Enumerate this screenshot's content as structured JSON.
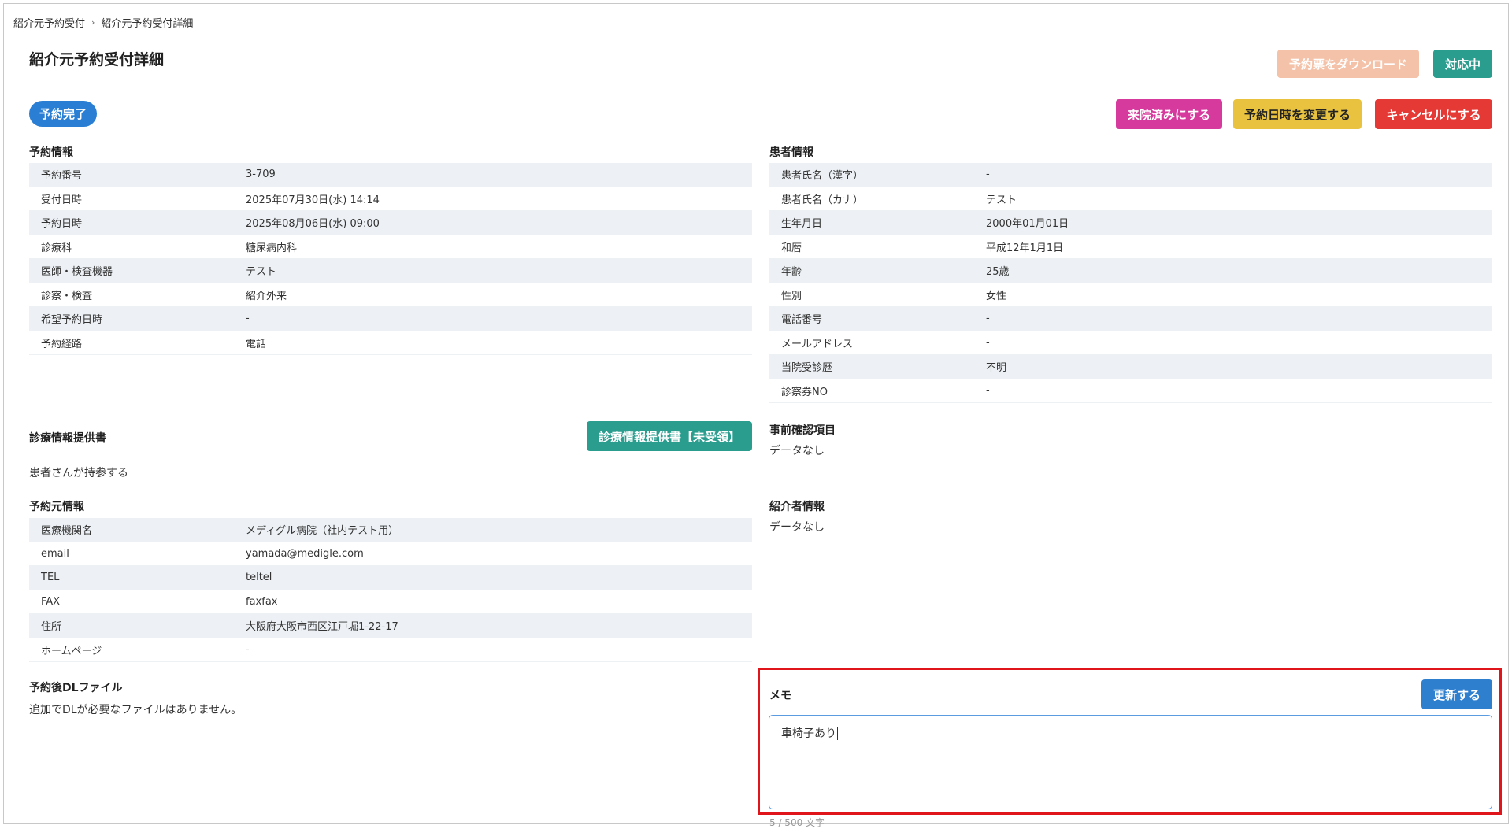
{
  "breadcrumb": {
    "items": [
      "紹介元予約受付",
      "紹介元予約受付詳細"
    ],
    "separator": "›"
  },
  "page_title": "紹介元予約受付詳細",
  "header_buttons": {
    "download": "予約票をダウンロード",
    "status": "対応中"
  },
  "status_badge": "予約完了",
  "action_buttons": {
    "visited": "来院済みにする",
    "reschedule": "予約日時を変更する",
    "cancel": "キャンセルにする"
  },
  "reservation_info": {
    "title": "予約情報",
    "rows": [
      {
        "label": "予約番号",
        "value": "3-709"
      },
      {
        "label": "受付日時",
        "value": "2025年07月30日(水) 14:14"
      },
      {
        "label": "予約日時",
        "value": "2025年08月06日(水) 09:00"
      },
      {
        "label": "診療科",
        "value": "糖尿病内科"
      },
      {
        "label": "医師・検査機器",
        "value": "テスト"
      },
      {
        "label": "診察・検査",
        "value": "紹介外来"
      },
      {
        "label": "希望予約日時",
        "value": "-"
      },
      {
        "label": "予約経路",
        "value": "電話"
      }
    ]
  },
  "patient_info": {
    "title": "患者情報",
    "rows": [
      {
        "label": "患者氏名（漢字）",
        "value": "-"
      },
      {
        "label": "患者氏名（カナ）",
        "value": "テスト"
      },
      {
        "label": "生年月日",
        "value": "2000年01月01日"
      },
      {
        "label": "和暦",
        "value": "平成12年1月1日"
      },
      {
        "label": "年齢",
        "value": "25歳"
      },
      {
        "label": "性別",
        "value": "女性"
      },
      {
        "label": "電話番号",
        "value": "-"
      },
      {
        "label": "メールアドレス",
        "value": "-"
      },
      {
        "label": "当院受診歴",
        "value": "不明"
      },
      {
        "label": "診察券NO",
        "value": "-"
      }
    ]
  },
  "referral_document": {
    "title": "診療情報提供書",
    "button": "診療情報提供書【未受領】",
    "note": "患者さんが持参する"
  },
  "pre_check": {
    "title": "事前確認項目",
    "empty": "データなし"
  },
  "source_info": {
    "title": "予約元情報",
    "rows": [
      {
        "label": "医療機関名",
        "value": "メディグル病院（社内テスト用）"
      },
      {
        "label": "email",
        "value": "yamada@medigle.com"
      },
      {
        "label": "TEL",
        "value": "teltel"
      },
      {
        "label": "FAX",
        "value": "faxfax"
      },
      {
        "label": "住所",
        "value": "大阪府大阪市西区江戸堀1-22-17"
      },
      {
        "label": "ホームページ",
        "value": "-"
      }
    ]
  },
  "referrer_info": {
    "title": "紹介者情報",
    "empty": "データなし"
  },
  "post_files": {
    "title": "予約後DLファイル",
    "note": "追加でDLが必要なファイルはありません。"
  },
  "memo": {
    "title": "メモ",
    "update_button": "更新する",
    "value": "車椅子あり",
    "char_count": "5 / 500 文字"
  },
  "colors": {
    "teal": "#2a9d8f",
    "badge_blue": "#2a7fd4",
    "pink": "#d63a9c",
    "yellow": "#e9c340",
    "red": "#e53935",
    "download_disabled": "#f4c2a8",
    "highlight_border": "#e0151c"
  }
}
